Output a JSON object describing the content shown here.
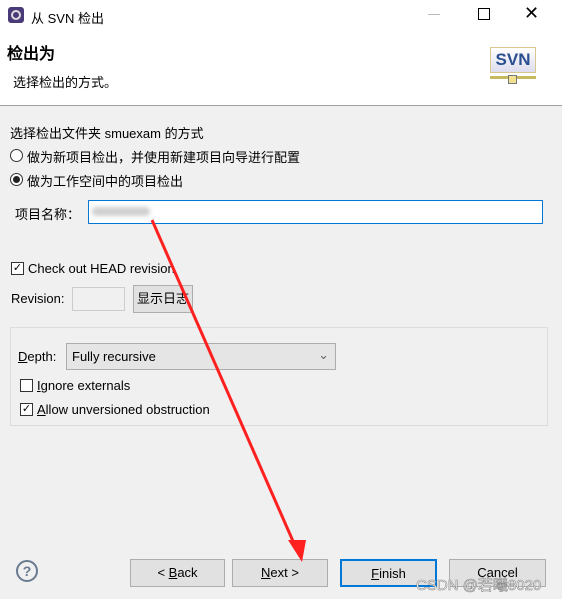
{
  "window": {
    "title": "从 SVN 检出",
    "icon": "eclipse-icon",
    "controls": [
      "minimize",
      "maximize",
      "close"
    ]
  },
  "header": {
    "title": "检出为",
    "subtitle": "选择检出的方式。",
    "logo": "SVN"
  },
  "form": {
    "prompt": "选择检出文件夹 smuexam 的方式",
    "radio_new": {
      "label": "做为新项目检出，并使用新建项目向导进行配置",
      "checked": false
    },
    "radio_workspace": {
      "label": "做为工作空间中的项目检出",
      "checked": true
    },
    "project_name_label": "项目名称：",
    "project_name_value": "",
    "head_revision": {
      "label": "Check out HEAD revision",
      "checked": true
    },
    "revision_label": "Revision:",
    "revision_value": "",
    "show_log": "显示日志",
    "depth_label_u": "D",
    "depth_label": "epth:",
    "depth_value": "Fully recursive",
    "ignore_externals": {
      "u": "I",
      "label": "gnore externals",
      "checked": false
    },
    "allow_unversioned": {
      "u": "A",
      "label": "llow unversioned obstruction",
      "checked": true
    }
  },
  "buttons": {
    "back_pre": "< ",
    "back_u": "B",
    "back": "ack",
    "next_u": "N",
    "next": "ext >",
    "finish_u": "F",
    "finish": "inish",
    "cancel": "Cancel"
  },
  "watermark": "CSDN @若曦8020",
  "annotation_color": "#ff2020"
}
